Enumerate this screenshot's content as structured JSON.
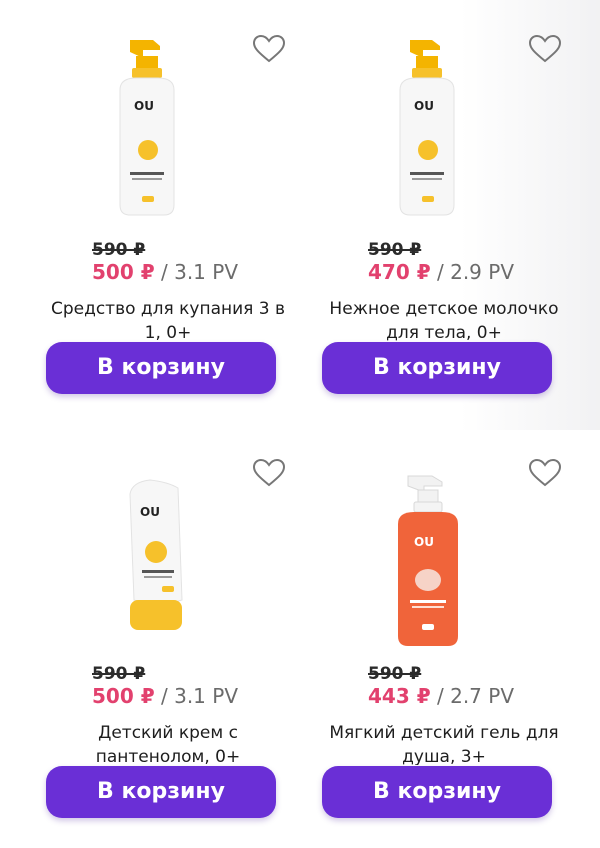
{
  "products": [
    {
      "old_price": "590 ₽",
      "price": "500 ₽",
      "pv": " / 3.1 PV",
      "name": "Средство для купания 3 в 1, 0+",
      "button": "В корзину",
      "image_icon": "shampoo-bottle-yellow"
    },
    {
      "old_price": "590 ₽",
      "price": "470 ₽",
      "pv": " / 2.9 PV",
      "name": "Нежное детское молочко для тела, 0+",
      "button": "В корзину",
      "image_icon": "lotion-bottle-yellow"
    },
    {
      "old_price": "590 ₽",
      "price": "500 ₽",
      "pv": " / 3.1 PV",
      "name": "Детский крем с пантенолом, 0+",
      "button": "В корзину",
      "image_icon": "cream-tube-yellow"
    },
    {
      "old_price": "590 ₽",
      "price": "443 ₽",
      "pv": " / 2.7 PV",
      "name": "Мягкий детский гель для душа, 3+",
      "button": "В корзину",
      "image_icon": "gel-bottle-orange"
    }
  ],
  "colors": {
    "accent_button": "#6a2fd6",
    "price": "#e2416e",
    "pv": "#6b6b6b",
    "old_price": "#2b2b2b"
  }
}
